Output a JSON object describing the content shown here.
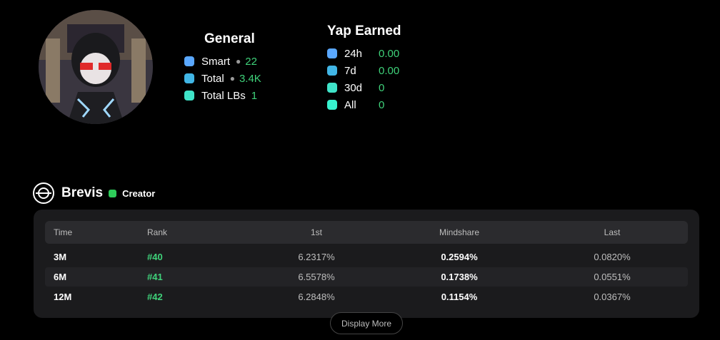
{
  "general": {
    "title": "General",
    "rows": [
      {
        "label": "Smart",
        "value": "22",
        "color": "#5aa8ff",
        "has_icon": true
      },
      {
        "label": "Total",
        "value": "3.4K",
        "color": "#41b6e6",
        "has_icon": true
      },
      {
        "label": "Total LBs",
        "value": "1",
        "color": "#3fe3c8",
        "has_icon": false
      }
    ]
  },
  "yap": {
    "title": "Yap Earned",
    "rows": [
      {
        "label": "24h",
        "value": "0.00",
        "color": "#5aa8ff"
      },
      {
        "label": "7d",
        "value": "0.00",
        "color": "#41b6e6"
      },
      {
        "label": "30d",
        "value": "0",
        "color": "#3fe3c8"
      },
      {
        "label": "All",
        "value": "0",
        "color": "#37f2cf"
      }
    ]
  },
  "project": {
    "name": "Brevis",
    "badge": "Creator",
    "badge_color": "#2ecc5a"
  },
  "table": {
    "headers": {
      "time": "Time",
      "rank": "Rank",
      "first": "1st",
      "mindshare": "Mindshare",
      "last": "Last"
    },
    "rows": [
      {
        "time": "3M",
        "rank": "#40",
        "first": "6.2317%",
        "mindshare": "0.2594%",
        "last": "0.0820%"
      },
      {
        "time": "6M",
        "rank": "#41",
        "first": "6.5578%",
        "mindshare": "0.1738%",
        "last": "0.0551%"
      },
      {
        "time": "12M",
        "rank": "#42",
        "first": "6.2848%",
        "mindshare": "0.1154%",
        "last": "0.0367%"
      }
    ]
  },
  "display_more_label": "Display More"
}
